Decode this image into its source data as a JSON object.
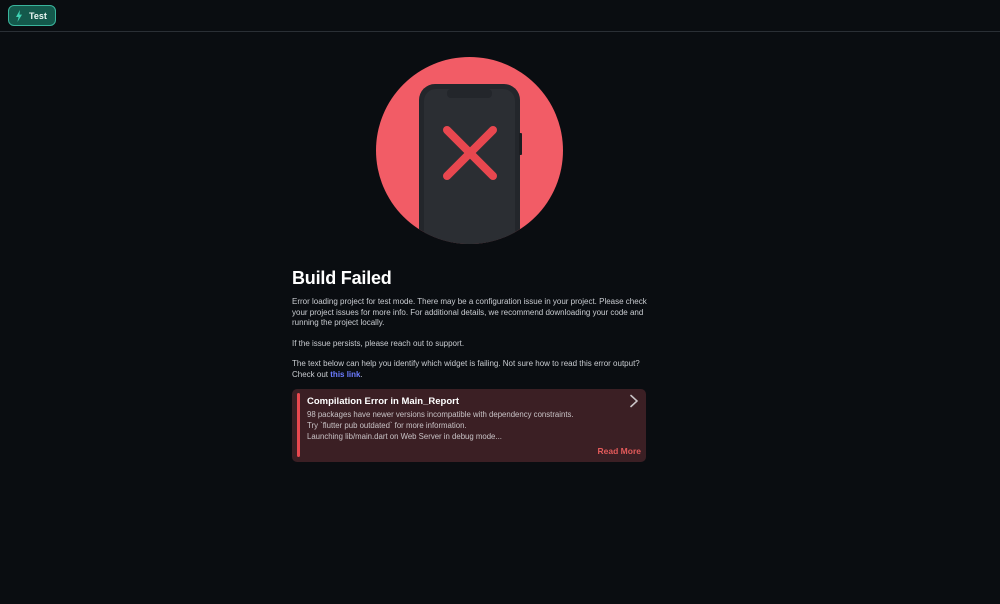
{
  "toolbar": {
    "test_label": "Test"
  },
  "main": {
    "title": "Build Failed",
    "description": "Error loading project for test mode. There may be a configuration issue in your project. Please check your project issues for more info. For additional details, we recommend downloading your code and running the project locally.",
    "support_text": "If the issue persists, please reach out to support.",
    "help_text": "The text below can help you identify which widget is failing. Not sure how to read this error output? Check out",
    "link_text": "this link",
    "link_suffix": "."
  },
  "error_card": {
    "title": "Compilation Error in Main_Report",
    "lines": [
      "98 packages have newer versions incompatible with dependency constraints.",
      "Try `flutter pub outdated` for more information.",
      "Launching lib/main.dart on Web Server in debug mode..."
    ],
    "read_more_label": "Read More"
  },
  "colors": {
    "background": "#0a0d11",
    "accent_green": "#39b49c",
    "error_red": "#e8484f",
    "illustration_circle": "#f25c66",
    "link": "#6c7cff"
  },
  "icons": {
    "test_button": "lightning-bolt-icon",
    "illustration": "phone-error-x-icon",
    "card_expand": "chevron-right-icon"
  }
}
